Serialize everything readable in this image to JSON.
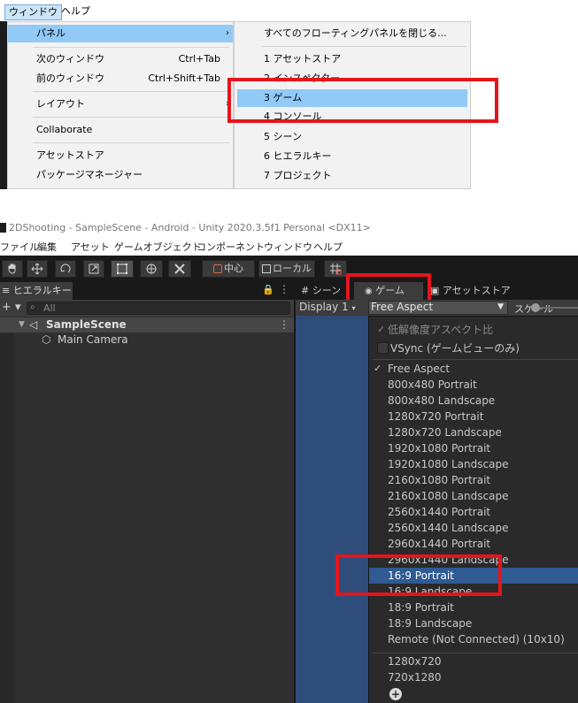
{
  "top_menu": {
    "menubar": [
      "ウィンドウ",
      "ヘルプ"
    ],
    "menu1": [
      {
        "label": "パネル",
        "shortcut": "",
        "arrow": "›"
      },
      {
        "label": "次のウィンドウ",
        "shortcut": "Ctrl+Tab",
        "arrow": ""
      },
      {
        "label": "前のウィンドウ",
        "shortcut": "Ctrl+Shift+Tab",
        "arrow": ""
      },
      {
        "label": "レイアウト",
        "shortcut": "",
        "arrow": "›"
      },
      {
        "label": "Collaborate",
        "shortcut": "",
        "arrow": ""
      },
      {
        "label": "アセットストア",
        "shortcut": "",
        "arrow": ""
      },
      {
        "label": "パッケージマネージャー",
        "shortcut": "",
        "arrow": ""
      }
    ],
    "menu2": [
      {
        "label": "すべてのフローティングパネルを閉じる..."
      },
      {
        "label": "1 アセットストア"
      },
      {
        "label": "2 インスペクター"
      },
      {
        "label": "3 ゲーム"
      },
      {
        "label": "4 コンソール"
      },
      {
        "label": "5 シーン"
      },
      {
        "label": "6 ヒエラルキー"
      },
      {
        "label": "7 プロジェクト"
      }
    ]
  },
  "unity": {
    "title": "2DShooting - SampleScene - Android - Unity 2020.3.5f1 Personal <DX11>",
    "menubar": [
      "ファイル",
      "編集",
      "アセット",
      "ゲームオブジェクト",
      "コンポーネント",
      "ウィンドウ",
      "ヘルプ"
    ],
    "toolbar": {
      "pivot_label": "中心",
      "space_label": "ローカル"
    },
    "hierarchy": {
      "tab": "ヒエラルキー",
      "search_placeholder": "All",
      "scene": "SampleScene",
      "camera": "Main Camera"
    },
    "tabs": {
      "scene": "シーン",
      "game": "ゲーム",
      "asset_store": "アセットストア"
    },
    "game_toolbar": {
      "display": "Display 1",
      "aspect": "Free Aspect",
      "scale_label": "スケール"
    },
    "dropdown": {
      "low_res": "低解像度アスペクト比",
      "vsync": "VSync (ゲームビューのみ)",
      "checkmark": "✓",
      "aspects": [
        "Free Aspect",
        "800x480 Portrait",
        "800x480 Landscape",
        "1280x720 Portrait",
        "1280x720 Landscape",
        "1920x1080 Portrait",
        "1920x1080 Landscape",
        "2160x1080 Portrait",
        "2160x1080 Landscape",
        "2560x1440 Portrait",
        "2560x1440 Landscape",
        "2960x1440 Portrait",
        "2960x1440 Landscape",
        "16:9 Portrait",
        "16:9 Landscape",
        "18:9 Portrait",
        "18:9 Landscape",
        "Remote (Not Connected) (10x10)"
      ],
      "fixed": [
        "1280x720",
        "720x1280"
      ],
      "add_label": "+"
    }
  }
}
